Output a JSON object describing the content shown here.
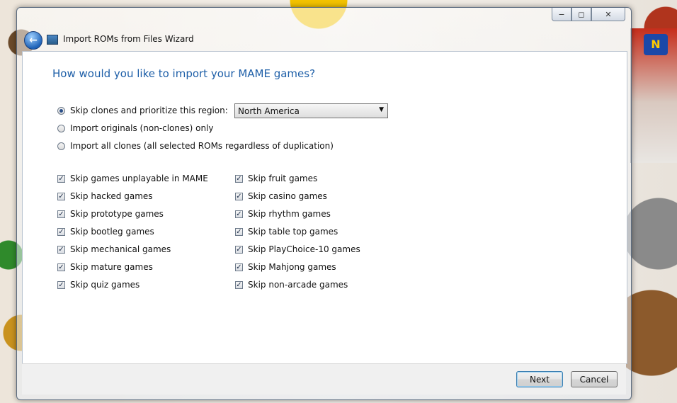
{
  "window": {
    "title": "Import ROMs from Files Wizard",
    "caption_minimize": "−",
    "caption_maximize": "◻",
    "caption_close": "✕",
    "back_glyph": "←"
  },
  "background": {
    "n64_label": "N"
  },
  "wizard": {
    "heading": "How would you like to import your MAME games?",
    "region_dropdown": {
      "selected": "North America"
    },
    "radio_options": [
      {
        "label": "Skip clones and prioritize this region:",
        "selected": true
      },
      {
        "label": "Import originals (non-clones) only",
        "selected": false
      },
      {
        "label": "Import all clones (all selected ROMs regardless of duplication)",
        "selected": false
      }
    ],
    "checkboxes_left": [
      {
        "label": "Skip games unplayable in MAME",
        "checked": true
      },
      {
        "label": "Skip hacked games",
        "checked": true
      },
      {
        "label": "Skip prototype games",
        "checked": true
      },
      {
        "label": "Skip bootleg games",
        "checked": true
      },
      {
        "label": "Skip mechanical games",
        "checked": true
      },
      {
        "label": "Skip mature games",
        "checked": true
      },
      {
        "label": "Skip quiz games",
        "checked": true
      }
    ],
    "checkboxes_right": [
      {
        "label": "Skip fruit games",
        "checked": true
      },
      {
        "label": "Skip casino games",
        "checked": true
      },
      {
        "label": "Skip rhythm games",
        "checked": true
      },
      {
        "label": "Skip table top games",
        "checked": true
      },
      {
        "label": "Skip PlayChoice-10 games",
        "checked": true
      },
      {
        "label": "Skip Mahjong games",
        "checked": true
      },
      {
        "label": "Skip non-arcade games",
        "checked": true
      }
    ]
  },
  "footer": {
    "next_label": "Next",
    "cancel_label": "Cancel"
  },
  "icons": {
    "back": "back-arrow-icon",
    "app": "app-icon",
    "check": "checkmark-icon",
    "dropdown": "chevron-down-icon"
  },
  "colors": {
    "heading": "#1e5fa8",
    "accent": "#3c7fb1"
  }
}
